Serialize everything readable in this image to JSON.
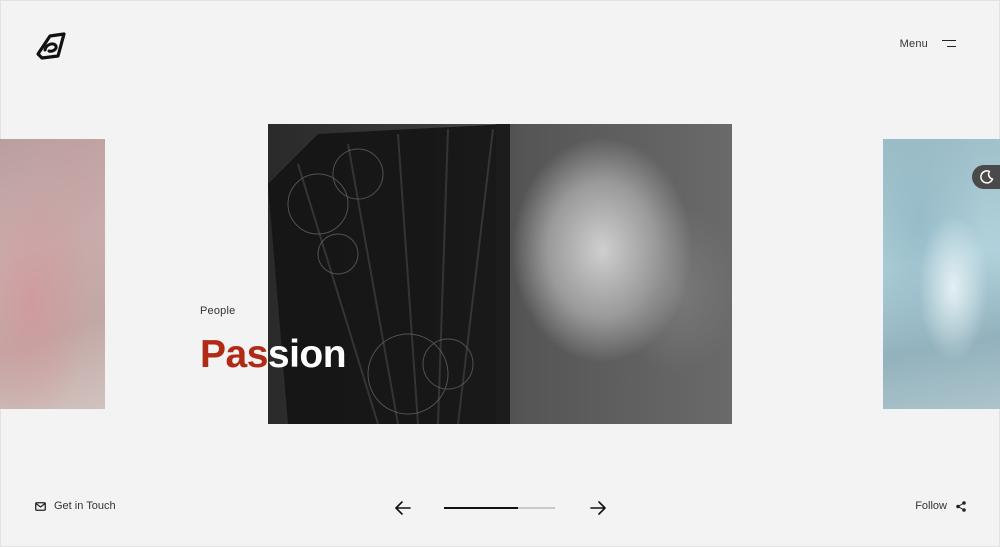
{
  "header": {
    "logo_icon": "brand-logo-icon",
    "menu_label": "Menu",
    "menu_icon": "hamburger-icon"
  },
  "slider": {
    "active": {
      "category": "People",
      "title_part_red": "Pas",
      "title_part_white": "sion",
      "image": "bw-woman-with-lace-fan"
    },
    "previous_image": "red-toned-interior",
    "next_image": "blue-ice-landscape",
    "progress": 0.67
  },
  "theme_toggle": {
    "icon": "moon-icon"
  },
  "footer": {
    "contact_label": "Get in Touch",
    "contact_icon": "envelope-icon",
    "follow_label": "Follow",
    "follow_icon": "share-icon",
    "prev_icon": "arrow-left-icon",
    "next_icon": "arrow-right-icon"
  },
  "colors": {
    "background": "#f3f3f3",
    "accent": "#b02a16",
    "text": "#222222"
  }
}
